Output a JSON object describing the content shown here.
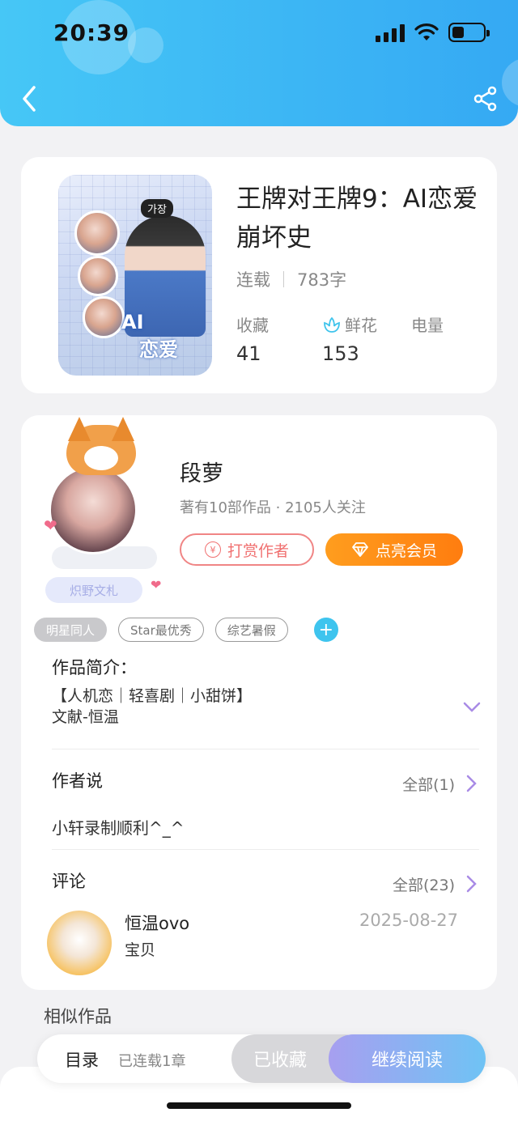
{
  "status_bar": {
    "time": "20:39"
  },
  "header": {
    "back_icon": "chevron-left-icon",
    "share_icon": "share-icon"
  },
  "book": {
    "title": "王牌对王牌9：AI恋爱崩坏史",
    "status": "连载",
    "word_count": "783字",
    "stats": [
      {
        "label": "收藏",
        "value": "41"
      },
      {
        "label": "鲜花",
        "value": "153",
        "icon": "flower-icon"
      },
      {
        "label": "电量",
        "value": ""
      }
    ],
    "cover_tag": "가장",
    "cover_text_1": "AI",
    "cover_text_2": "恋爱"
  },
  "author": {
    "name": "段萝",
    "meta": "著有10部作品 · 2105人关注",
    "badge": "炽野文札",
    "tip_button": "打赏作者",
    "vip_button": "点亮会员",
    "coin_symbol": "¥"
  },
  "tags": [
    "明星同人",
    "Star最优秀",
    "综艺暑假"
  ],
  "intro": {
    "title": "作品简介：",
    "line1": "【人机恋｜轻喜剧｜小甜饼】",
    "line2": "文献-恒温"
  },
  "author_say": {
    "title": "作者说",
    "see_all": "全部(1)",
    "text": "小轩录制顺利^_^"
  },
  "comments": {
    "title": "评论",
    "see_all": "全部(23)",
    "items": [
      {
        "name": "恒温ovo",
        "date": "2025-08-27",
        "text": "宝贝"
      }
    ]
  },
  "similar": {
    "title": "相似作品"
  },
  "bottom_bar": {
    "toc_label": "目录",
    "toc_sub": "已连载1章",
    "fav_label": "已收藏",
    "read_label": "继续阅读"
  },
  "colors": {
    "header_start": "#46c7f6",
    "header_end": "#35a9f3",
    "vip_orange": "#ff8a15",
    "tip_red": "#f07070",
    "accent_purple": "#a98be6",
    "tag_add_blue": "#3ec4ee"
  }
}
